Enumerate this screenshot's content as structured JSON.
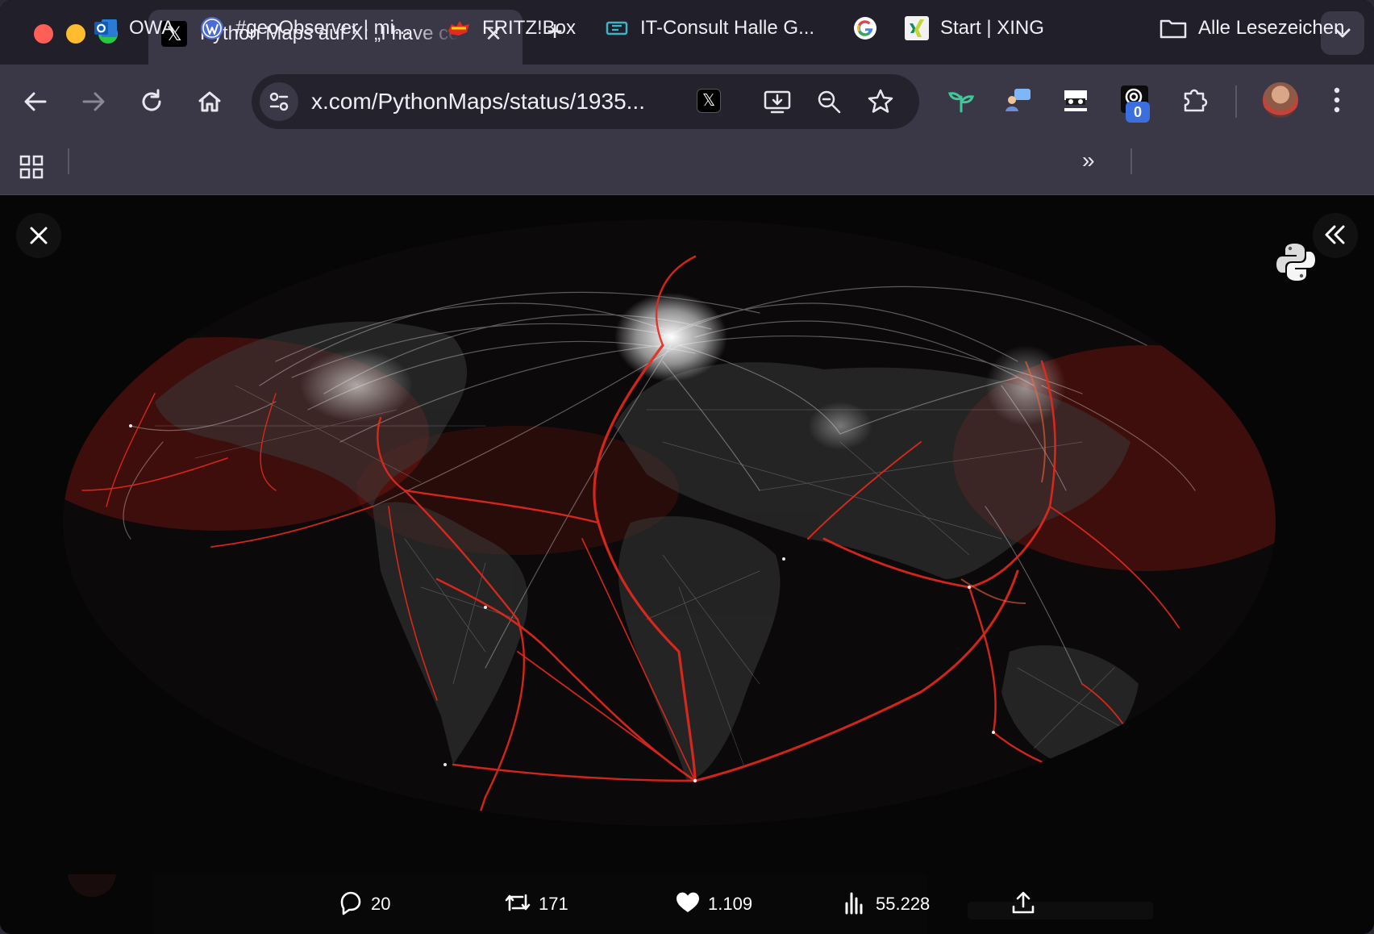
{
  "tab": {
    "title": "Python Maps auf X: „I have co",
    "favicon": "x-logo-icon"
  },
  "omnibox": {
    "url": "x.com/PythonMaps/status/1935..."
  },
  "extensions": {
    "badge_count": "0"
  },
  "bookmarks": {
    "items": [
      {
        "label": "OWA",
        "icon": "outlook-icon"
      },
      {
        "label": "#geoObserver | mi...",
        "icon": "wordpress-icon"
      },
      {
        "label": "FRITZ!Box",
        "icon": "fritzbox-icon"
      },
      {
        "label": "IT-Consult Halle G...",
        "icon": "itconsult-icon"
      },
      {
        "label": "",
        "icon": "google-icon"
      },
      {
        "label": "Start | XING",
        "icon": "xing-icon"
      }
    ],
    "overflow": "»",
    "all_bookmarks": "Alle Lesezeichen"
  },
  "post_actions": {
    "replies": "20",
    "reposts": "171",
    "likes": "1.109",
    "views": "55.228"
  },
  "colors": {
    "tabstrip": "#201f2a",
    "toolbar": "#3a3846",
    "shipping_routes": "#e8291c",
    "flight_routes": "#f2f2f2",
    "map_background": "#060606"
  }
}
